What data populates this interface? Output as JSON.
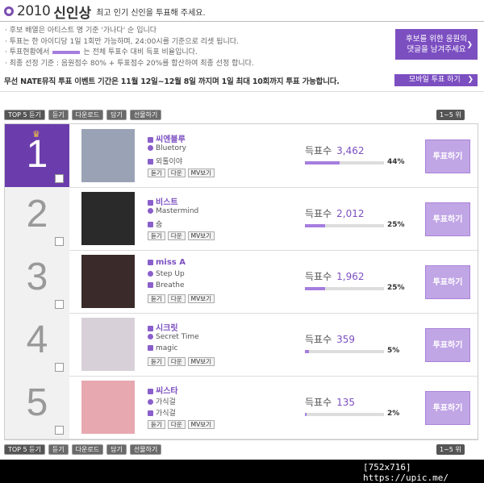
{
  "header": {
    "year": "2010",
    "title": "신인상",
    "subtitle": "최고 인기 신인을 투표해 주세요."
  },
  "notes": [
    "후보 배열은 아티스트 명 기준 '가나다' 순 입니다",
    "투표는 한 아이디당 1일 1회만 가능하며, 24:00시를 기준으로 리셋 됩니다.",
    "투표현황에서",
    "는 전체 투표수 대비 득표 비율입니다.",
    "최종 선정 기준 : 음원점수 80% + 투표점수 20%를 합산하여 최종 선정 합니다."
  ],
  "comment_button": {
    "line1": "후보를 위한 응원의",
    "line2": "댓글을 남겨주세요"
  },
  "period_text": "무선 NATE뮤직 투표 이벤트 기간은 11월 12일~12월 8일 까지며 1일 최대 10회까지 투표 가능합니다.",
  "mobile_vote_label": "모바일 투표 하기",
  "toolbar": {
    "top5": "TOP 5 듣기",
    "listen": "듣기",
    "download": "다운로드",
    "add": "담기",
    "gift": "선물하기",
    "pager": "1~5 위"
  },
  "labels": {
    "votes": "득표수",
    "vote_button": "투표하기",
    "listen": "듣기",
    "down": "다운",
    "mv": "MV보기"
  },
  "candidates": [
    {
      "rank": "1",
      "artist": "씨엔블루",
      "song1": "Bluetory",
      "song2": "외톨이야",
      "votes": "3,462",
      "percent": "44%",
      "ratio": 0.44,
      "thumb_color": "#9aa3b5"
    },
    {
      "rank": "2",
      "artist": "비스트",
      "song1": "Mastermind",
      "song2": "숨",
      "votes": "2,012",
      "percent": "25%",
      "ratio": 0.25,
      "thumb_color": "#2a2a2a"
    },
    {
      "rank": "3",
      "artist": "miss A",
      "song1": "Step Up",
      "song2": "Breathe",
      "votes": "1,962",
      "percent": "25%",
      "ratio": 0.25,
      "thumb_color": "#3a2a2a"
    },
    {
      "rank": "4",
      "artist": "시크릿",
      "song1": "Secret Time",
      "song2": "magic",
      "votes": "359",
      "percent": "5%",
      "ratio": 0.05,
      "thumb_color": "#d8d0d8"
    },
    {
      "rank": "5",
      "artist": "씨스타",
      "song1": "가식걸",
      "song2": "가식걸",
      "votes": "135",
      "percent": "2%",
      "ratio": 0.02,
      "thumb_color": "#e8a8b0"
    }
  ],
  "watermark": "[752x716] https://upic.me/"
}
